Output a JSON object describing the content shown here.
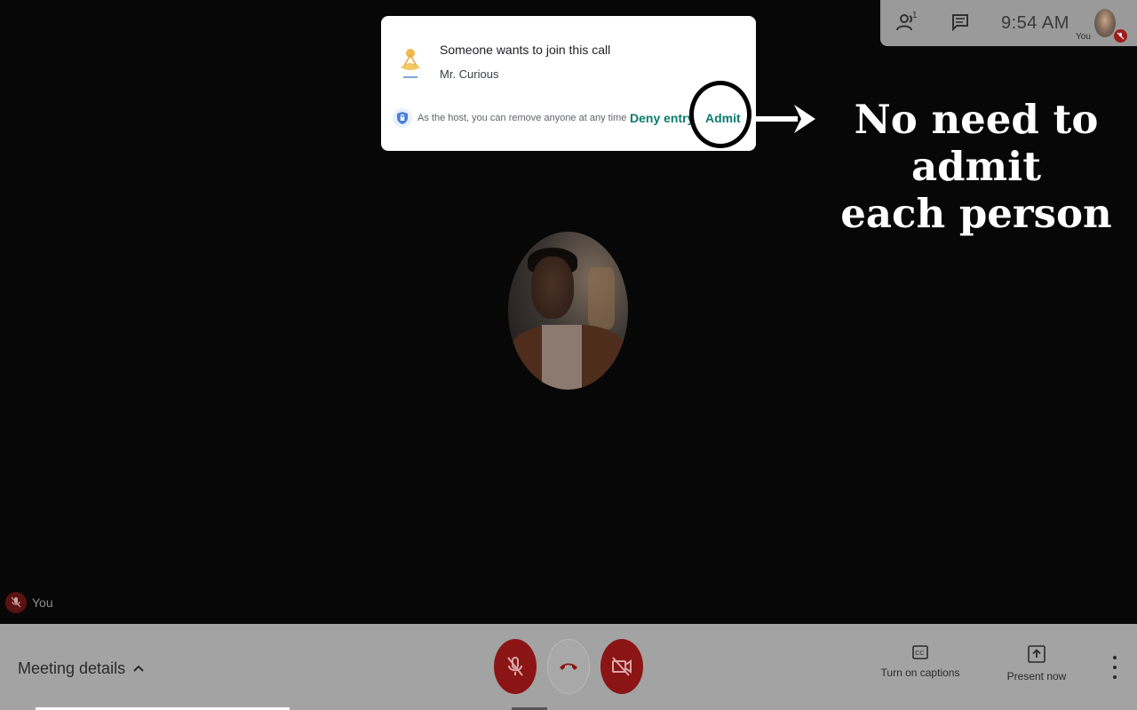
{
  "topbar": {
    "people_icon": "people-icon",
    "people_count": "1",
    "chat_icon": "chat-icon",
    "clock": "9:54 AM",
    "self_label": "You",
    "mic_status_icon": "mic-off-icon"
  },
  "dialog": {
    "title": "Someone wants to join this call",
    "guest_name": "Mr. Curious",
    "logo_icon": "guest-logo",
    "shield_icon": "shield-lock-icon",
    "note": "As the host, you can remove anyone at any time",
    "deny_label": "Deny entry",
    "admit_label": "Admit"
  },
  "annotation": {
    "callout_line1": "No need to admit",
    "callout_line2": "each person"
  },
  "participant": {
    "self_name": "You",
    "mic_icon": "mic-off-icon"
  },
  "controls": {
    "meeting_details_label": "Meeting details",
    "meeting_details_icon": "chevron-up-icon",
    "mic_icon": "mic-off-icon",
    "hangup_icon": "hangup-icon",
    "camera_icon": "camera-off-icon",
    "captions_label": "Turn on captions",
    "captions_icon": "cc-icon",
    "present_label": "Present now",
    "present_icon": "present-icon",
    "more_icon": "more-vert-icon"
  },
  "colors": {
    "accent_teal": "#0b7b6f",
    "mute_red": "#8b1515",
    "dialog_bg": "#ffffff",
    "stage_bg": "#070707"
  }
}
